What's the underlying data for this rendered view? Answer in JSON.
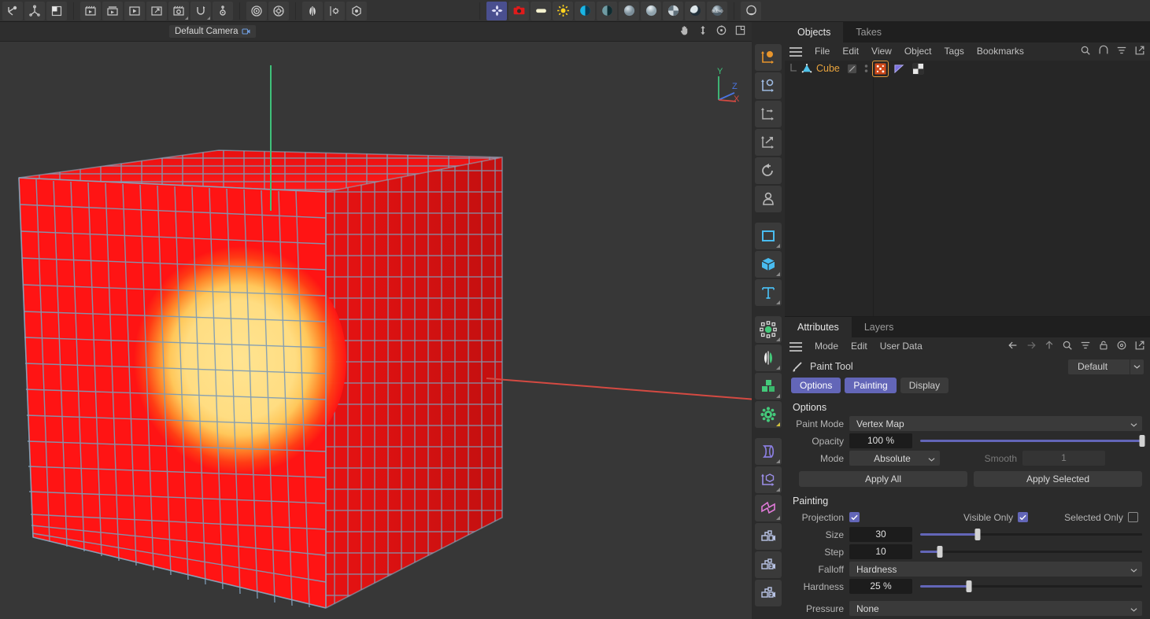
{
  "toolbar": {
    "groups": [
      {
        "name": "transform",
        "items": [
          {
            "name": "undo-icon",
            "label": "Undo"
          },
          {
            "name": "axis-move-icon",
            "label": "Move Axis"
          },
          {
            "name": "render-region-icon",
            "label": "Render Region"
          }
        ]
      },
      {
        "name": "render",
        "items": [
          {
            "name": "render-view-icon",
            "label": "Render View"
          },
          {
            "name": "render-queue-icon",
            "label": "Render Queue"
          },
          {
            "name": "render-picture-viewer-icon",
            "label": "Render to Picture Viewer"
          },
          {
            "name": "render-external-icon",
            "label": "Render External"
          },
          {
            "name": "render-settings-icon",
            "label": "Render Settings"
          },
          {
            "name": "simulate-icon",
            "label": "Simulate"
          },
          {
            "name": "project-settings-icon",
            "label": "Project Settings"
          }
        ]
      },
      {
        "name": "scene",
        "items": [
          {
            "name": "target-icon",
            "label": "Target"
          },
          {
            "name": "gear-circle-icon",
            "label": "Options"
          }
        ]
      },
      {
        "name": "tools",
        "items": [
          {
            "name": "symmetry-icon",
            "label": "Symmetry"
          },
          {
            "name": "settings-gear-icon",
            "label": "Settings"
          },
          {
            "name": "visibility-icon",
            "label": "Visibility"
          }
        ]
      },
      {
        "name": "materials",
        "items": [
          {
            "name": "nodes-icon",
            "label": "Node Editor",
            "selected": true
          },
          {
            "name": "camera-icon",
            "label": "Camera"
          },
          {
            "name": "light-area-icon",
            "label": "Area Light"
          },
          {
            "name": "sun-icon",
            "label": "Sun"
          },
          {
            "name": "contrast-icon",
            "label": "Contrast"
          },
          {
            "name": "half-sphere-icon",
            "label": "Half Sphere"
          },
          {
            "name": "sphere-grey-icon",
            "label": "Default Material"
          },
          {
            "name": "sphere-glossy-icon",
            "label": "Glossy Material"
          },
          {
            "name": "sphere-checker-icon",
            "label": "Checker Material"
          },
          {
            "name": "sphere-shadow-icon",
            "label": "Shadow Material"
          },
          {
            "name": "blend-material-icon",
            "label": "BLEND"
          }
        ]
      },
      {
        "name": "last",
        "items": [
          {
            "name": "sphere-outline-icon",
            "label": "Sphere Outline"
          }
        ]
      }
    ]
  },
  "viewport": {
    "camera_label": "Default Camera",
    "camera_icon": "camera-tag-icon",
    "nav_icons": [
      {
        "name": "pan-hand-icon",
        "label": "Pan"
      },
      {
        "name": "dolly-icon",
        "label": "Dolly"
      },
      {
        "name": "orbit-icon",
        "label": "Rotate"
      },
      {
        "name": "maximize-view-icon",
        "label": "Maximize Viewport"
      }
    ],
    "axis_gizmo": {
      "y": "Y",
      "z": "Z",
      "x": "X",
      "y_color": "#3fc17a",
      "z_color": "#4a74e0",
      "x_color": "#d44a42"
    },
    "object_colors": {
      "vertex_map_base": "#ff1414",
      "vertex_map_painted": "#ffe07a",
      "wireframe": "#7d9bb5",
      "background": "#373737"
    }
  },
  "tool_column": {
    "items": [
      {
        "name": "tool-move-axis-icon",
        "label": "Move"
      },
      {
        "name": "tool-scale-icon",
        "label": "Scale"
      },
      {
        "name": "tool-rotate-axis-icon",
        "label": "Rotate Axis"
      },
      {
        "name": "tool-transform-icon",
        "label": "Transform"
      },
      {
        "name": "tool-undo-view-icon",
        "label": "Undo View"
      },
      {
        "name": "tool-figure-icon",
        "label": "Character"
      },
      {
        "name": "tool-spline-rect-icon",
        "label": "Rectangle Spline"
      },
      {
        "name": "tool-cube-icon",
        "label": "Cube Primitive"
      },
      {
        "name": "tool-text-icon",
        "label": "Text"
      },
      {
        "name": "tool-points-icon",
        "label": "Points"
      },
      {
        "name": "tool-symmetry-deformer-icon",
        "label": "Symmetry Deformer"
      },
      {
        "name": "tool-cloner-icon",
        "label": "Cloner"
      },
      {
        "name": "tool-effector-icon",
        "label": "Effector"
      },
      {
        "name": "tool-bend-deformer-icon",
        "label": "Bend Deformer"
      },
      {
        "name": "tool-array-icon",
        "label": "Array"
      },
      {
        "name": "tool-field-icon",
        "label": "Field"
      },
      {
        "name": "tool-camera-move-icon",
        "label": "Camera Move"
      },
      {
        "name": "tool-camera-morph-icon",
        "label": "Camera Morph"
      },
      {
        "name": "tool-camera-motion-icon",
        "label": "Camera Motion"
      }
    ]
  },
  "objects_panel": {
    "tabs": [
      {
        "label": "Objects",
        "active": true
      },
      {
        "label": "Takes",
        "active": false
      }
    ],
    "menu": [
      "File",
      "Edit",
      "View",
      "Object",
      "Tags",
      "Bookmarks"
    ],
    "menu_icons": [
      {
        "name": "search-icon",
        "label": "Search"
      },
      {
        "name": "home-icon",
        "label": "Home"
      },
      {
        "name": "filter-icon",
        "label": "Filter"
      },
      {
        "name": "popout-icon",
        "label": "Open as Separate Window"
      }
    ],
    "rows": [
      {
        "name": "Cube",
        "icon": "polygon-object-icon",
        "visibility_icon": "visibility-dots-icon",
        "tags": [
          {
            "name": "vertex-map-tag",
            "label": "Vertex Map",
            "selected": true
          },
          {
            "name": "phong-tag",
            "label": "Phong",
            "selected": false
          },
          {
            "name": "texture-tag",
            "label": "Texture",
            "selected": false
          }
        ]
      }
    ]
  },
  "attributes_panel": {
    "tabs": [
      {
        "label": "Attributes",
        "active": true
      },
      {
        "label": "Layers",
        "active": false
      }
    ],
    "menu": [
      "Mode",
      "Edit",
      "User Data"
    ],
    "menu_icons": [
      {
        "name": "back-arrow-icon",
        "label": "Back"
      },
      {
        "name": "forward-arrow-icon",
        "label": "Forward"
      },
      {
        "name": "up-arrow-icon",
        "label": "Up"
      },
      {
        "name": "search-icon",
        "label": "Search"
      },
      {
        "name": "filter-icon",
        "label": "Filter"
      },
      {
        "name": "lock-icon",
        "label": "Lock"
      },
      {
        "name": "target-circle-icon",
        "label": "Target"
      },
      {
        "name": "popout-icon",
        "label": "Open as Separate Window"
      }
    ],
    "tool_title": "Paint Tool",
    "tool_icon": "paint-brush-icon",
    "preset": {
      "value": "Default",
      "arrow_icon": "chevron-down-icon"
    },
    "subtabs": [
      {
        "label": "Options",
        "active": true
      },
      {
        "label": "Painting",
        "active": true
      },
      {
        "label": "Display",
        "active": false
      }
    ],
    "options": {
      "heading": "Options",
      "paint_mode": {
        "label": "Paint Mode",
        "value": "Vertex Map"
      },
      "opacity": {
        "label": "Opacity",
        "value": "100 %",
        "percent": 100
      },
      "mode": {
        "label": "Mode",
        "value": "Absolute"
      },
      "smooth": {
        "label": "Smooth",
        "value": "1"
      },
      "apply_all": "Apply All",
      "apply_selected": "Apply Selected"
    },
    "painting": {
      "heading": "Painting",
      "projection": {
        "label": "Projection",
        "checked": true
      },
      "visible_only": {
        "label": "Visible Only",
        "checked": true
      },
      "selected_only": {
        "label": "Selected Only",
        "checked": false
      },
      "size": {
        "label": "Size",
        "value": "30",
        "percent": 26
      },
      "step": {
        "label": "Step",
        "value": "10",
        "percent": 9
      },
      "falloff": {
        "label": "Falloff",
        "value": "Hardness"
      },
      "hardness": {
        "label": "Hardness",
        "value": "25 %",
        "percent": 22
      },
      "pressure": {
        "label": "Pressure",
        "value": "None"
      }
    }
  }
}
